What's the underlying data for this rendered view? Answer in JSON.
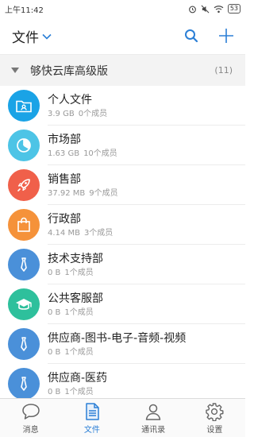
{
  "status_bar": {
    "time": "上午11:42",
    "battery": "53"
  },
  "header": {
    "title": "文件"
  },
  "group": {
    "name": "够快云库高级版",
    "count": "(11)"
  },
  "files": [
    {
      "name": "个人文件",
      "size": "3.9 GB",
      "members": "0个成员",
      "color": "#1aa3e6",
      "icon": "folder-user-icon"
    },
    {
      "name": "市场部",
      "size": "1.63 GB",
      "members": "10个成员",
      "color": "#4dc4e6",
      "icon": "pie-chart-icon"
    },
    {
      "name": "销售部",
      "size": "37.92 MB",
      "members": "9个成员",
      "color": "#f0604a",
      "icon": "rocket-icon"
    },
    {
      "name": "行政部",
      "size": "4.14 MB",
      "members": "3个成员",
      "color": "#f5923a",
      "icon": "shopping-bag-icon"
    },
    {
      "name": "技术支持部",
      "size": "0 B",
      "members": "1个成员",
      "color": "#4a90d9",
      "icon": "necktie-icon"
    },
    {
      "name": "公共客服部",
      "size": "0 B",
      "members": "1个成员",
      "color": "#2ec09c",
      "icon": "graduation-cap-icon"
    },
    {
      "name": "供应商-图书-电子-音频-视频",
      "size": "0 B",
      "members": "1个成员",
      "color": "#4a90d9",
      "icon": "necktie-icon"
    },
    {
      "name": "供应商-医药",
      "size": "0 B",
      "members": "1个成员",
      "color": "#4a90d9",
      "icon": "necktie-icon"
    }
  ],
  "tabs": [
    {
      "label": "消息",
      "icon": "chat-bubble-icon",
      "active": false
    },
    {
      "label": "文件",
      "icon": "document-icon",
      "active": true
    },
    {
      "label": "通讯录",
      "icon": "contact-icon",
      "active": false
    },
    {
      "label": "设置",
      "icon": "gear-icon",
      "active": false
    }
  ],
  "colors": {
    "accent": "#2b7fd6",
    "group_bg": "#f3f3f3"
  }
}
